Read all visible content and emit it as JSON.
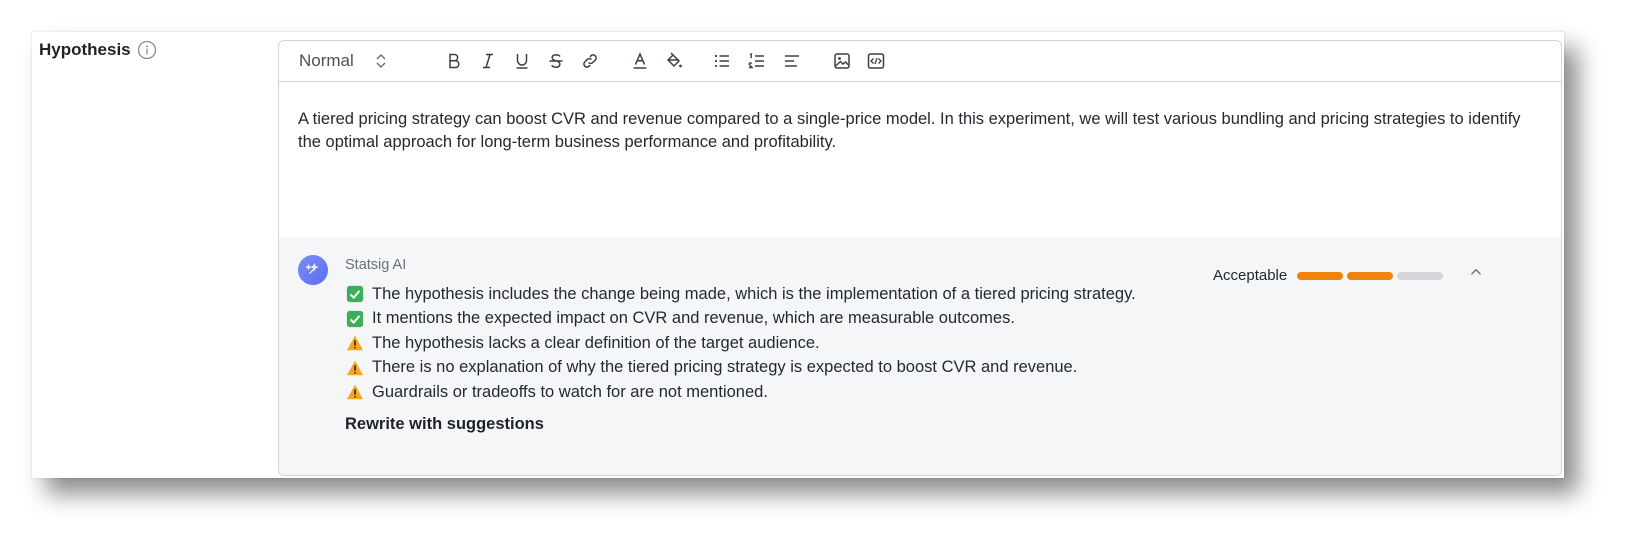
{
  "field": {
    "label": "Hypothesis"
  },
  "toolbar": {
    "format_value": "Normal",
    "buttons": [
      "bold-icon",
      "italic-icon",
      "underline-icon",
      "strikethrough-icon",
      "link-icon",
      "text-color-icon",
      "fill-color-icon",
      "bullet-list-icon",
      "numbered-list-icon",
      "align-icon",
      "image-icon",
      "code-icon"
    ]
  },
  "editor": {
    "text": "A tiered pricing strategy can boost CVR and revenue compared to a single-price model. In this experiment, we will test various bundling and pricing strategies to identify the optimal approach for long-term business performance and profitability."
  },
  "ai": {
    "name": "Statsig AI",
    "feedback": [
      {
        "status": "check",
        "text": "The hypothesis includes the change being made, which is the implementation of a tiered pricing strategy."
      },
      {
        "status": "check",
        "text": "It mentions the expected impact on CVR and revenue, which are measurable outcomes."
      },
      {
        "status": "warning",
        "text": "The hypothesis lacks a clear definition of the target audience."
      },
      {
        "status": "warning",
        "text": "There is no explanation of why the tiered pricing strategy is expected to boost CVR and revenue."
      },
      {
        "status": "warning",
        "text": "Guardrails or tradeoffs to watch for are not mentioned."
      }
    ],
    "rewrite_label": "Rewrite with suggestions",
    "rating": {
      "label": "Acceptable",
      "filled": 2,
      "total": 3,
      "filled_color": "#f0840a",
      "empty_color": "#d4d6da"
    }
  }
}
